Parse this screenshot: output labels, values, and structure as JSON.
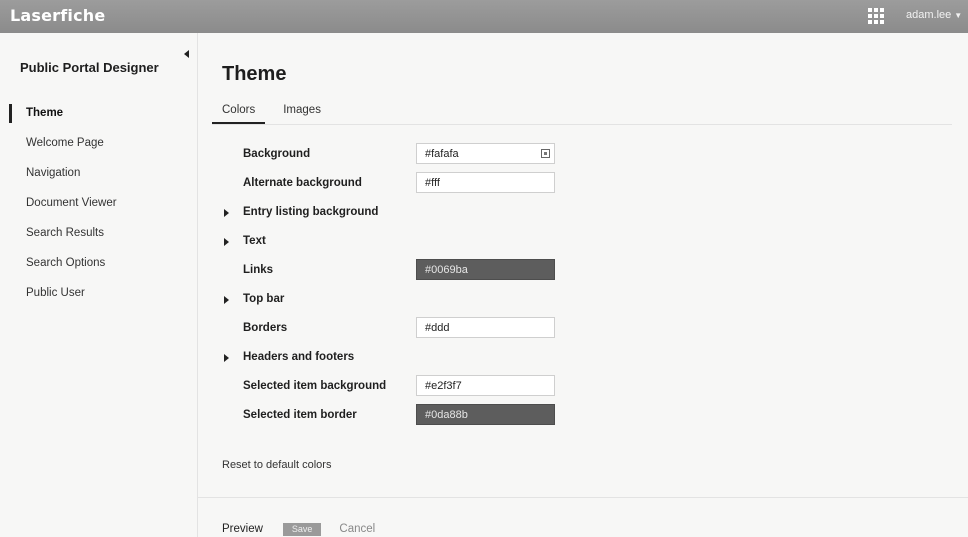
{
  "topbar": {
    "brand": "Laserfiche",
    "apps_icon": "apps-grid-icon",
    "user": "adam.lee",
    "user_caret_icon": "caret-down-icon"
  },
  "sidebar": {
    "title": "Public Portal Designer",
    "collapse_icon": "collapse-left-arrow-icon",
    "items": [
      {
        "label": "Theme",
        "active": true
      },
      {
        "label": "Welcome Page"
      },
      {
        "label": "Navigation"
      },
      {
        "label": "Document Viewer"
      },
      {
        "label": "Search Results"
      },
      {
        "label": "Search Options"
      },
      {
        "label": "Public User"
      }
    ]
  },
  "main": {
    "title": "Theme",
    "tabs": [
      {
        "label": "Colors",
        "active": true
      },
      {
        "label": "Images"
      }
    ],
    "colors": {
      "background": {
        "label": "Background",
        "value": "#fafafa"
      },
      "alternate_background": {
        "label": "Alternate background",
        "value": "#fff"
      },
      "entry_listing_background": {
        "label": "Entry listing background"
      },
      "text": {
        "label": "Text"
      },
      "links": {
        "label": "Links",
        "value": "#0069ba"
      },
      "top_bar": {
        "label": "Top bar"
      },
      "borders": {
        "label": "Borders",
        "value": "#ddd"
      },
      "headers_and_footers": {
        "label": "Headers and footers"
      },
      "selected_item_background": {
        "label": "Selected item background",
        "value": "#e2f3f7"
      },
      "selected_item_border": {
        "label": "Selected item border",
        "value": "#0da88b"
      }
    },
    "reset_label": "Reset to default colors"
  },
  "footer": {
    "preview_label": "Preview",
    "save_label": "Save",
    "cancel_label": "Cancel"
  }
}
